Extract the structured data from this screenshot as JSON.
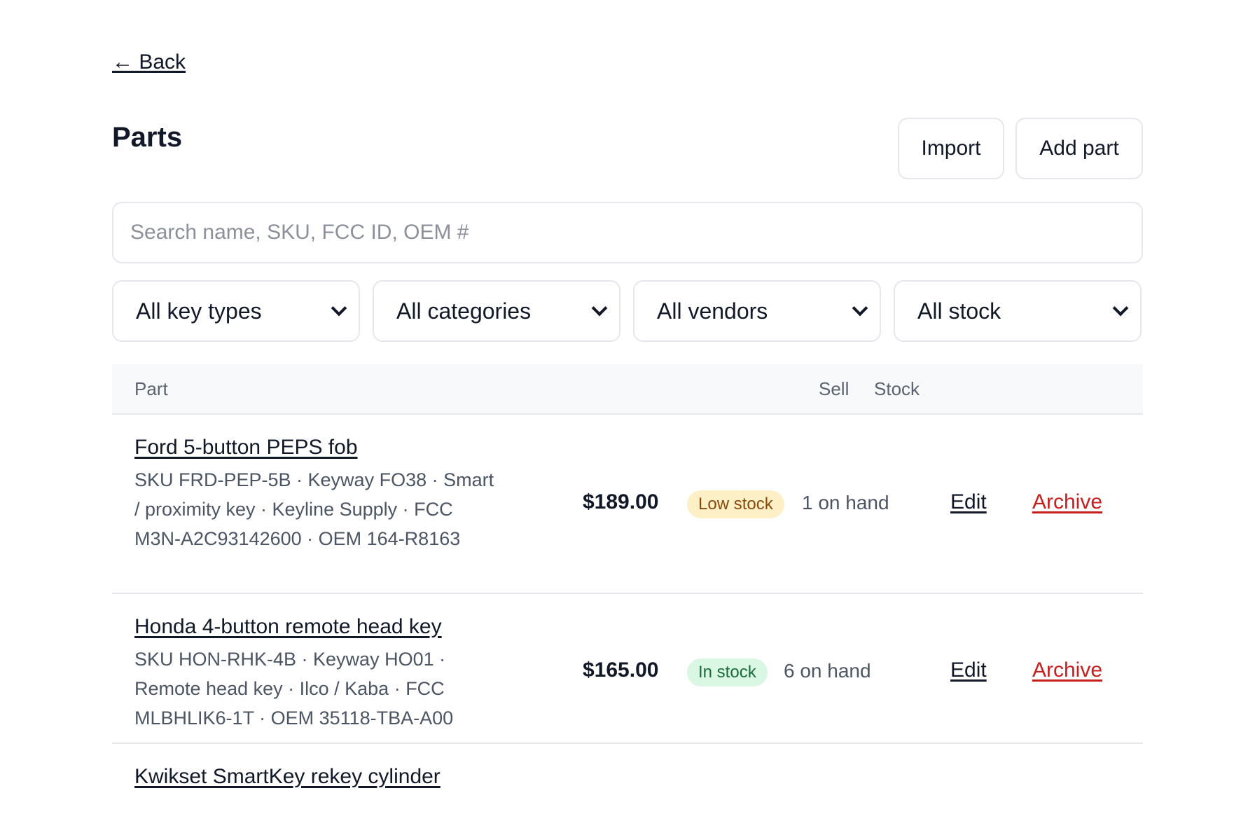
{
  "nav": {
    "back_label": "← Back"
  },
  "header": {
    "title": "Parts",
    "import_label": "Import",
    "add_label": "Add part"
  },
  "search": {
    "placeholder": "Search name, SKU, FCC ID, OEM #",
    "value": ""
  },
  "filters": {
    "key_types": "All key types",
    "categories": "All categories",
    "vendors": "All vendors",
    "stock": "All stock"
  },
  "table": {
    "columns": {
      "part": "Part",
      "sell": "Sell",
      "stock": "Stock"
    },
    "rows": [
      {
        "name": "Ford 5-button PEPS fob",
        "meta": "SKU FRD-PEP-5B · Keyway FO38 · Smart / proximity key · Keyline Supply · FCC M3N-A2C93142600 · OEM 164-R8163",
        "price": "$189.00",
        "status": "Low stock",
        "on_hand": "1 on hand",
        "edit": "Edit",
        "archive": "Archive"
      },
      {
        "name": "Honda 4-button remote head key",
        "meta": "SKU HON-RHK-4B · Keyway HO01 · Remote head key · Ilco / Kaba · FCC MLBHLIK6-1T · OEM 35118-TBA-A00",
        "price": "$165.00",
        "status": "In stock",
        "on_hand": "6 on hand",
        "edit": "Edit",
        "archive": "Archive"
      },
      {
        "name": "Kwikset SmartKey rekey cylinder"
      }
    ]
  },
  "colors": {
    "low_stock_bg": "#fdf0c6",
    "low_stock_text": "#8a4a0c",
    "in_stock_bg": "#d9f7e3",
    "in_stock_text": "#196c3a",
    "danger": "#c81e1e"
  }
}
